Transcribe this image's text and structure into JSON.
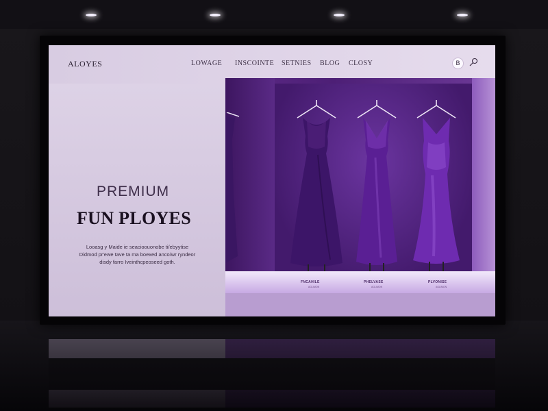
{
  "brand": {
    "name": "ALOYES"
  },
  "nav": {
    "items": [
      "LOWAGE",
      "INSCOINTE",
      "SETNIES",
      "BLOG",
      "CLOSY"
    ]
  },
  "header": {
    "badge_label": "B",
    "icon": "search-icon"
  },
  "hero": {
    "subtitle": "PREMIUM",
    "title": "FUN PLOYES",
    "description": "Looasg y Maide ie seacioouonobe ti/ebyytise Didmod pr'ewe tave ta ma boexed anco/wr ryndeor disdy farro Iveinthcpeoseed goth."
  },
  "showcase": {
    "labels": [
      {
        "name": "FNCAHILE",
        "sub": "AGLIMON"
      },
      {
        "name": "PHELVASE",
        "sub": "AGLIMON"
      },
      {
        "name": "PLVONISE",
        "sub": "AGLIMON"
      }
    ]
  },
  "colors": {
    "accent": "#5a2a86",
    "dress": "#3c1568",
    "dress_highlight": "#7f3cc0",
    "panel": "#d9cde3"
  }
}
